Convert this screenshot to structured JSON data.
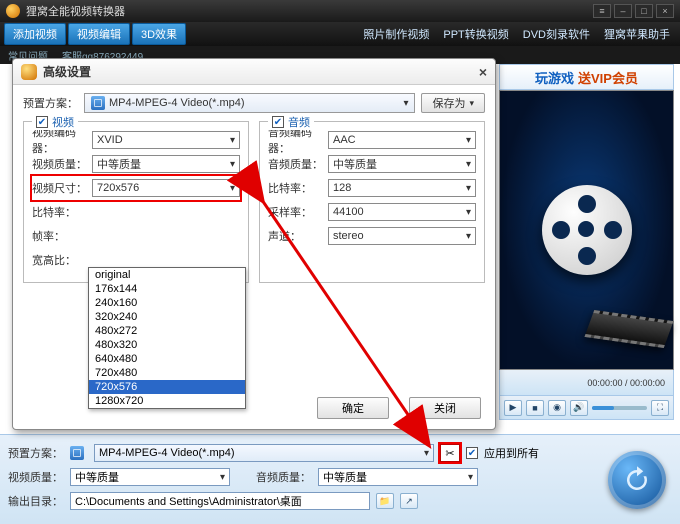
{
  "window": {
    "title": "狸窝全能视频转换器",
    "min": "–",
    "max": "□",
    "close": "×"
  },
  "toolbar": {
    "add_video": "添加视频",
    "edit_video": "视频编辑",
    "effect_3d": "3D效果",
    "link_photo": "照片制作视频",
    "link_ppt": "PPT转换视频",
    "link_dvd": "DVD刻录软件",
    "link_apple": "狸窝苹果助手"
  },
  "subbar": {
    "faq": "常见问题",
    "kefu": "客服qq876292449"
  },
  "banner": {
    "t1": "玩游戏",
    "t2": "送VIP会员"
  },
  "video_ctrl": {
    "time": "00:00:00 / 00:00:00"
  },
  "bottom": {
    "preset_label": "预置方案：",
    "preset_value": "MP4-MPEG-4 Video(*.mp4)",
    "apply_all": "应用到所有",
    "vq_label": "视频质量：",
    "vq_value": "中等质量",
    "aq_label": "音频质量：",
    "aq_value": "中等质量",
    "out_label": "输出目录：",
    "out_value": "C:\\Documents and Settings\\Administrator\\桌面",
    "tool_icon": "✂"
  },
  "dialog": {
    "title": "高级设置",
    "preset_label": "预置方案：",
    "preset_value": "MP4-MPEG-4 Video(*.mp4)",
    "save_as": "保存为",
    "ok": "确定",
    "cancel": "关闭",
    "video": {
      "legend": "视频",
      "codec_label": "视频编码器：",
      "codec": "XVID",
      "vq_label": "视频质量：",
      "vq": "中等质量",
      "size_label": "视频尺寸：",
      "size": "720x576",
      "bitrate_label": "比特率：",
      "fps_label": "帧率：",
      "aspect_label": "宽高比："
    },
    "audio": {
      "legend": "音频",
      "codec_label": "音频编码器：",
      "codec": "AAC",
      "aq_label": "音频质量：",
      "aq": "中等质量",
      "bitrate_label": "比特率：",
      "bitrate": "128",
      "sr_label": "采样率：",
      "sr": "44100",
      "ch_label": "声道：",
      "ch": "stereo"
    },
    "size_options": [
      "original",
      "176x144",
      "240x160",
      "320x240",
      "480x272",
      "480x320",
      "640x480",
      "720x480",
      "720x576",
      "1280x720"
    ],
    "size_selected_index": 8
  }
}
